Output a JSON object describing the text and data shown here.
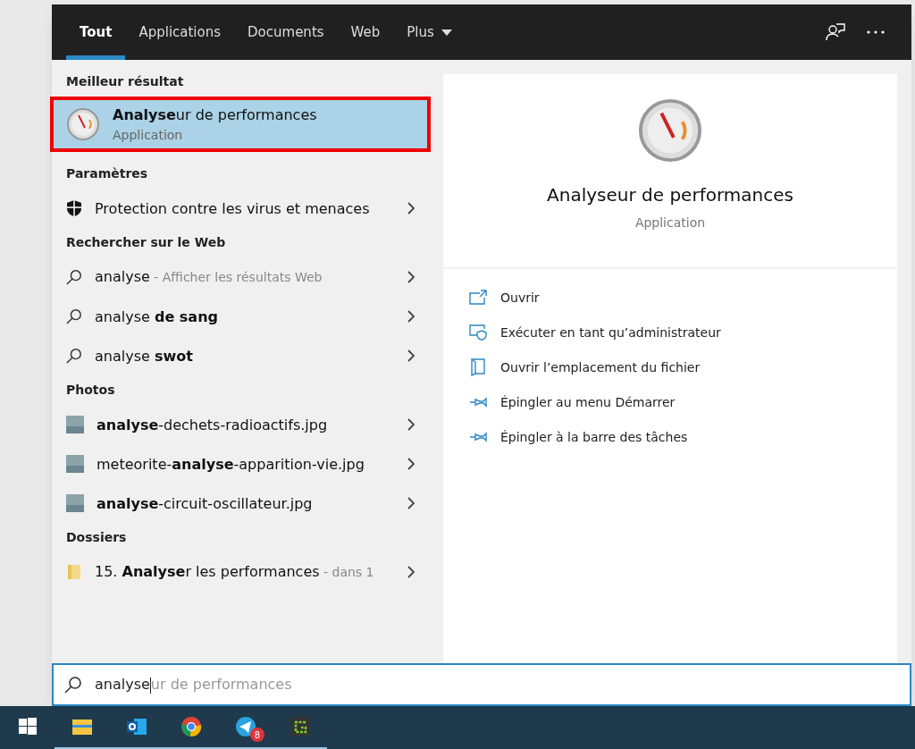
{
  "tabs": [
    {
      "label": "Tout",
      "selected": true
    },
    {
      "label": "Applications",
      "selected": false
    },
    {
      "label": "Documents",
      "selected": false
    },
    {
      "label": "Web",
      "selected": false
    },
    {
      "label": "Plus",
      "selected": false,
      "dropdown": true
    }
  ],
  "sections": [
    {
      "heading": "Meilleur résultat",
      "items": [
        {
          "kind": "app",
          "title": "**Analyse**ur de performances",
          "subtitle": "Application",
          "selected": true
        }
      ]
    },
    {
      "heading": "Paramètres",
      "items": [
        {
          "kind": "shield",
          "title": "Protection contre les virus et menaces"
        }
      ]
    },
    {
      "heading": "Rechercher sur le Web",
      "items": [
        {
          "kind": "search",
          "title": "analyse",
          "hint": "- Afficher les résultats Web"
        },
        {
          "kind": "search",
          "title": "analyse **de sang**"
        },
        {
          "kind": "search",
          "title": "analyse **swot**"
        }
      ]
    },
    {
      "heading": "Photos",
      "items": [
        {
          "kind": "photo",
          "title": "**analyse**-dechets-radioactifs.jpg"
        },
        {
          "kind": "photo",
          "title": "meteorite-**analyse**-apparition-vie.jpg"
        },
        {
          "kind": "photo",
          "title": "**analyse**-circuit-oscillateur.jpg"
        }
      ]
    },
    {
      "heading": "Dossiers",
      "items": [
        {
          "kind": "folder",
          "title": "15. **Analyse**r les performances",
          "hint": "- dans 1"
        }
      ]
    }
  ],
  "preview": {
    "title": "Analyseur de performances",
    "subtitle": "Application"
  },
  "actions": [
    {
      "kind": "open",
      "label": "Ouvrir"
    },
    {
      "kind": "admin",
      "label": "Exécuter en tant qu’administrateur"
    },
    {
      "kind": "location",
      "label": "Ouvrir l’emplacement du fichier"
    },
    {
      "kind": "pin",
      "label": "Épingler au menu Démarrer"
    },
    {
      "kind": "pin",
      "label": "Épingler à la barre des tâches"
    }
  ],
  "search": {
    "value": "analyse",
    "suggestion": "ur de performances"
  },
  "taskbar": [
    {
      "kind": "start"
    },
    {
      "kind": "explorer",
      "running": true
    },
    {
      "kind": "outlook",
      "running": true
    },
    {
      "kind": "chrome",
      "running": true
    },
    {
      "kind": "telegram",
      "running": true,
      "badge": "8"
    },
    {
      "kind": "greenshot",
      "running": true
    }
  ]
}
